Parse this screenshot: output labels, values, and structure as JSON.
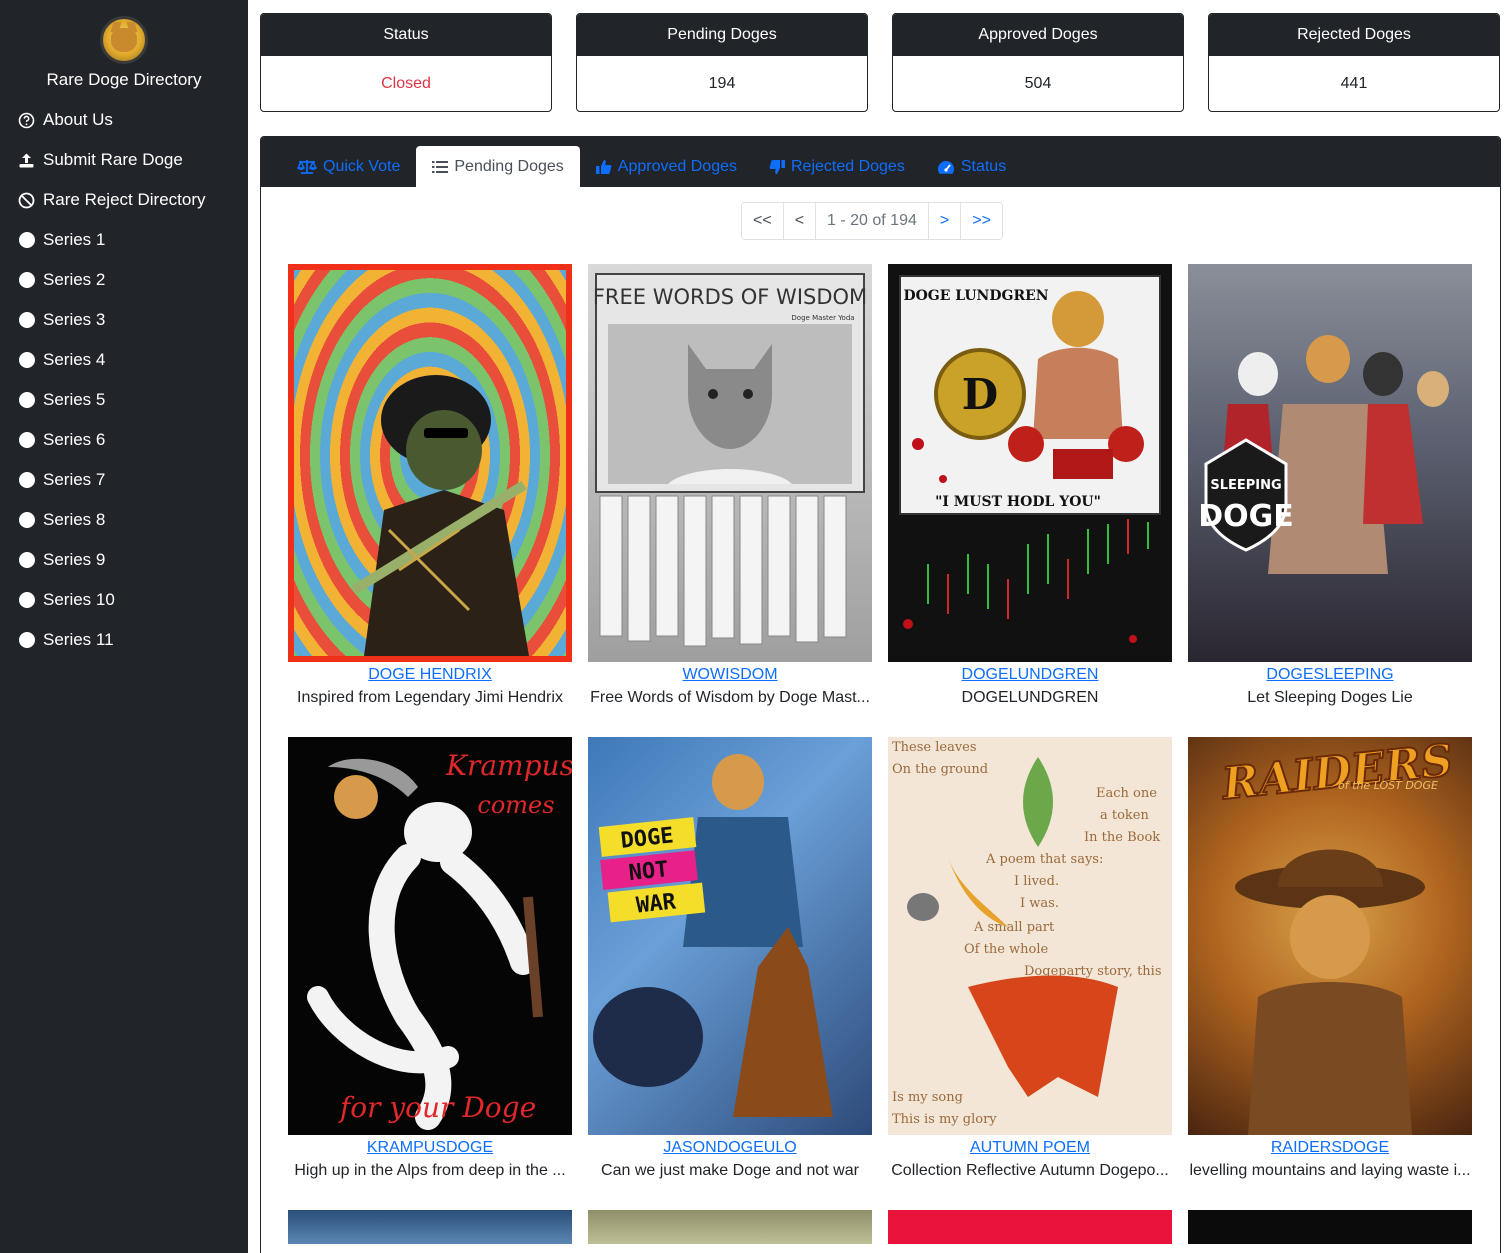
{
  "sidebar": {
    "brand_title": "Rare Doge Directory",
    "items": [
      {
        "label": "About Us",
        "icon": "question-circle-icon"
      },
      {
        "label": "Submit Rare Doge",
        "icon": "upload-icon"
      },
      {
        "label": "Rare Reject Directory",
        "icon": "ban-icon"
      },
      {
        "label": "Series 1",
        "icon": "circle-icon"
      },
      {
        "label": "Series 2",
        "icon": "circle-icon"
      },
      {
        "label": "Series 3",
        "icon": "circle-icon"
      },
      {
        "label": "Series 4",
        "icon": "circle-icon"
      },
      {
        "label": "Series 5",
        "icon": "circle-icon"
      },
      {
        "label": "Series 6",
        "icon": "circle-icon"
      },
      {
        "label": "Series 7",
        "icon": "circle-icon"
      },
      {
        "label": "Series 8",
        "icon": "circle-icon"
      },
      {
        "label": "Series 9",
        "icon": "circle-icon"
      },
      {
        "label": "Series 10",
        "icon": "circle-icon"
      },
      {
        "label": "Series 11",
        "icon": "circle-icon"
      }
    ]
  },
  "stats": [
    {
      "title": "Status",
      "value": "Closed"
    },
    {
      "title": "Pending Doges",
      "value": "194"
    },
    {
      "title": "Approved Doges",
      "value": "504"
    },
    {
      "title": "Rejected Doges",
      "value": "441"
    }
  ],
  "tabs": [
    {
      "label": "Quick Vote",
      "icon": "balance-scale-icon",
      "active": false
    },
    {
      "label": "Pending Doges",
      "icon": "list-icon",
      "active": true
    },
    {
      "label": "Approved Doges",
      "icon": "thumbs-up-icon",
      "active": false
    },
    {
      "label": "Rejected Doges",
      "icon": "thumbs-down-icon",
      "active": false
    },
    {
      "label": "Status",
      "icon": "tachometer-icon",
      "active": false
    }
  ],
  "pagination": {
    "first": "<<",
    "prev": "<",
    "info": "1 - 20 of 194",
    "next": ">",
    "last": ">>"
  },
  "doges": [
    {
      "name": "DOGE HENDRIX",
      "description": "Inspired from Legendary Jimi Hendrix"
    },
    {
      "name": "WOWISDOM",
      "description": "Free Words of Wisdom by Doge Mast..."
    },
    {
      "name": "DOGELUNDGREN",
      "description": "DOGELUNDGREN"
    },
    {
      "name": "DOGESLEEPING",
      "description": "Let Sleeping Doges Lie"
    },
    {
      "name": "KRAMPUSDOGE",
      "description": "High up in the Alps from deep in the ..."
    },
    {
      "name": "JASONDOGEULO",
      "description": "Can we just make Doge and not war"
    },
    {
      "name": "AUTUMN POEM",
      "description": "Collection Reflective Autumn Dogepo..."
    },
    {
      "name": "RAIDERSDOGE",
      "description": "levelling mountains and laying waste i..."
    }
  ],
  "artwork_text": {
    "wowisdom_header": "FREE WORDS OF WISDOM",
    "wowisdom_sub": "Doge Master Yoda",
    "lundgren_header": "DOGE LUNDGREN",
    "lundgren_footer": "\"I MUST HODL YOU\"",
    "lundgren_coin": "D",
    "sleeping_line1": "SLEEPING",
    "sleeping_line2": "DOGE",
    "krampus_top1": "Krampus",
    "krampus_top2": "comes",
    "krampus_bottom": "for your Doge",
    "jason_line1": "DOGE",
    "jason_line2": "NOT",
    "jason_line3": "WAR",
    "poem_line1": "These leaves",
    "poem_line2": "On the ground",
    "poem_line3": "Each one",
    "poem_line4": "a token",
    "poem_line5": "In the Book",
    "poem_line6": "A poem that says:",
    "poem_line7": "I lived.",
    "poem_line8": "I was.",
    "poem_line9": "A small part",
    "poem_line10": "Of the whole",
    "poem_line11": "Dogeparty story, this",
    "poem_line12": "Is my song",
    "poem_line13": "This is my glory",
    "raiders_title": "RAIDERS",
    "raiders_sub": "of the LOST DOGE"
  },
  "colors": {
    "sidebar_bg": "#212529",
    "link": "#0d6efd",
    "closed_status": "#dc3545"
  }
}
